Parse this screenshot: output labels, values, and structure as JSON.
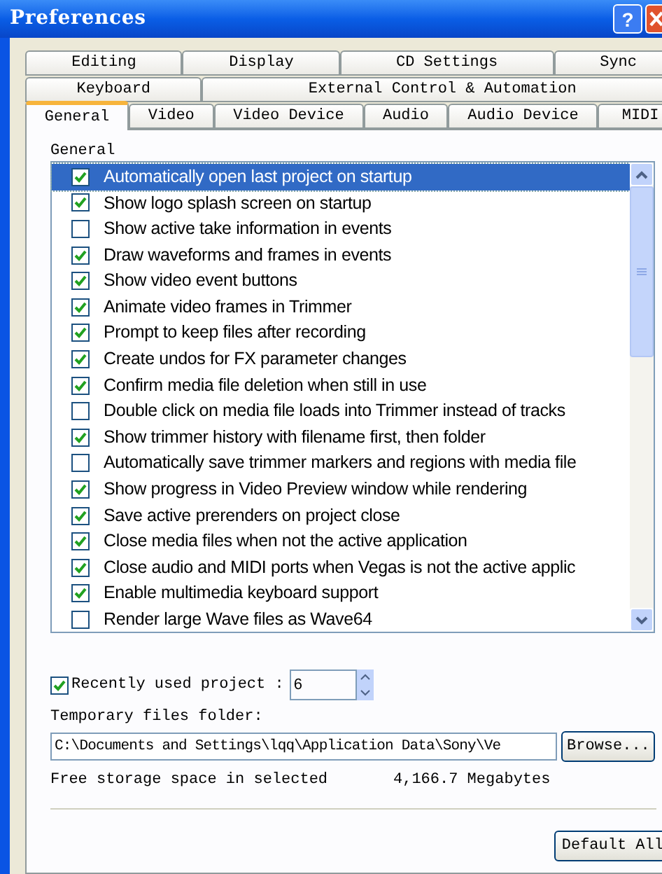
{
  "window": {
    "title": "Preferences",
    "help_button": "?"
  },
  "tab_rows": [
    [
      {
        "label": "Editing",
        "selected": false
      },
      {
        "label": "Display",
        "selected": false
      },
      {
        "label": "CD Settings",
        "selected": false
      },
      {
        "label": "Sync",
        "selected": false
      }
    ],
    [
      {
        "label": "Keyboard",
        "selected": false
      },
      {
        "label": "External Control & Automation",
        "selected": false
      }
    ],
    [
      {
        "label": "General",
        "selected": true
      },
      {
        "label": "Video",
        "selected": false
      },
      {
        "label": "Video Device",
        "selected": false
      },
      {
        "label": "Audio",
        "selected": false
      },
      {
        "label": "Audio Device",
        "selected": false
      },
      {
        "label": "MIDI",
        "selected": false
      }
    ]
  ],
  "group_label": "General",
  "options": [
    {
      "label": "Automatically open last project on startup",
      "checked": true,
      "selected": true
    },
    {
      "label": "Show logo splash screen on startup",
      "checked": true,
      "selected": false
    },
    {
      "label": "Show active take information in events",
      "checked": false,
      "selected": false
    },
    {
      "label": "Draw waveforms and frames in events",
      "checked": true,
      "selected": false
    },
    {
      "label": "Show video event buttons",
      "checked": true,
      "selected": false
    },
    {
      "label": "Animate video frames in Trimmer",
      "checked": true,
      "selected": false
    },
    {
      "label": "Prompt to keep files after recording",
      "checked": true,
      "selected": false
    },
    {
      "label": "Create undos for FX parameter changes",
      "checked": true,
      "selected": false
    },
    {
      "label": "Confirm media file deletion when still in use",
      "checked": true,
      "selected": false
    },
    {
      "label": "Double click on media file loads into Trimmer instead of tracks",
      "checked": false,
      "selected": false
    },
    {
      "label": "Show trimmer history with filename first, then folder",
      "checked": true,
      "selected": false
    },
    {
      "label": "Automatically save trimmer markers and regions with media file",
      "checked": false,
      "selected": false
    },
    {
      "label": "Show progress in Video Preview window while rendering",
      "checked": true,
      "selected": false
    },
    {
      "label": "Save active prerenders on project close",
      "checked": true,
      "selected": false
    },
    {
      "label": "Close media files when not the active application",
      "checked": true,
      "selected": false
    },
    {
      "label": "Close audio and MIDI ports when Vegas is not the active applic",
      "checked": true,
      "selected": false
    },
    {
      "label": "Enable multimedia keyboard support",
      "checked": true,
      "selected": false
    },
    {
      "label": "Render large Wave files as Wave64",
      "checked": false,
      "selected": false
    }
  ],
  "recent_projects": {
    "checked": true,
    "label": "Recently used project :",
    "value": "6"
  },
  "temp_folder": {
    "label": "Temporary files folder:",
    "value": "C:\\Documents and Settings\\lqq\\Application Data\\Sony\\Ve",
    "button": "Browse..."
  },
  "free_space": {
    "label": "Free storage space in selected",
    "value": "4,166.7 Megabytes"
  },
  "default_button": "Default All"
}
